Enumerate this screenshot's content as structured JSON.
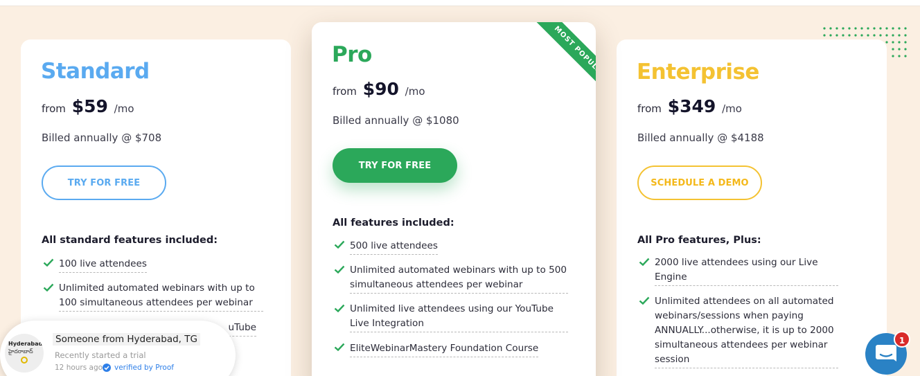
{
  "colors": {
    "background": "#fbefe2",
    "standard_accent": "#5aaaf0",
    "pro_accent": "#2ba85a",
    "enterprise_accent": "#f4c232",
    "check": "#2ba85a",
    "chat_button": "#2a82c5",
    "badge": "#d92a2a"
  },
  "plans": {
    "standard": {
      "name": "Standard",
      "from": "from",
      "price": "$59",
      "per": "/mo",
      "billed": "Billed annually @ $708",
      "button": "TRY FOR FREE",
      "features_heading": "All standard features included:",
      "features": [
        "100 live attendees",
        "Unlimited automated webinars with up to 100 simultaneous attendees per webinar",
        "uTube"
      ]
    },
    "pro": {
      "name": "Pro",
      "from": "from",
      "price": "$90",
      "per": "/mo",
      "billed": "Billed annually @ $1080",
      "button": "TRY FOR FREE",
      "ribbon": "MOST POPULAR",
      "features_heading": "All features included:",
      "features": [
        "500 live attendees",
        "Unlimited automated webinars with up to 500 simultaneous attendees per webinar",
        "Unlimited live attendees using our YouTube Live Integration",
        "EliteWebinarMastery Foundation Course"
      ]
    },
    "enterprise": {
      "name": "Enterprise",
      "from": "from",
      "price": "$349",
      "per": "/mo",
      "billed": "Billed annually @ $4188",
      "button": "SCHEDULE A DEMO",
      "features_heading": "All Pro features, Plus:",
      "features": [
        "2000 live attendees using our Live Engine",
        "Unlimited attendees on all automated webinars/sessions when paying ANNUALLY...otherwise, it is up to 2000 simultaneous attendees per webinar session"
      ]
    }
  },
  "toast": {
    "avatar_city": "Hyderabad",
    "avatar_city_local": "హైదరాబాద్",
    "title": "Someone from Hyderabad, TG",
    "subtitle": "Recently started a trial",
    "time": "12 hours ago",
    "verified": "verified by Proof"
  },
  "chat": {
    "icon": "chat-bubble-icon",
    "badge_count": "1"
  }
}
